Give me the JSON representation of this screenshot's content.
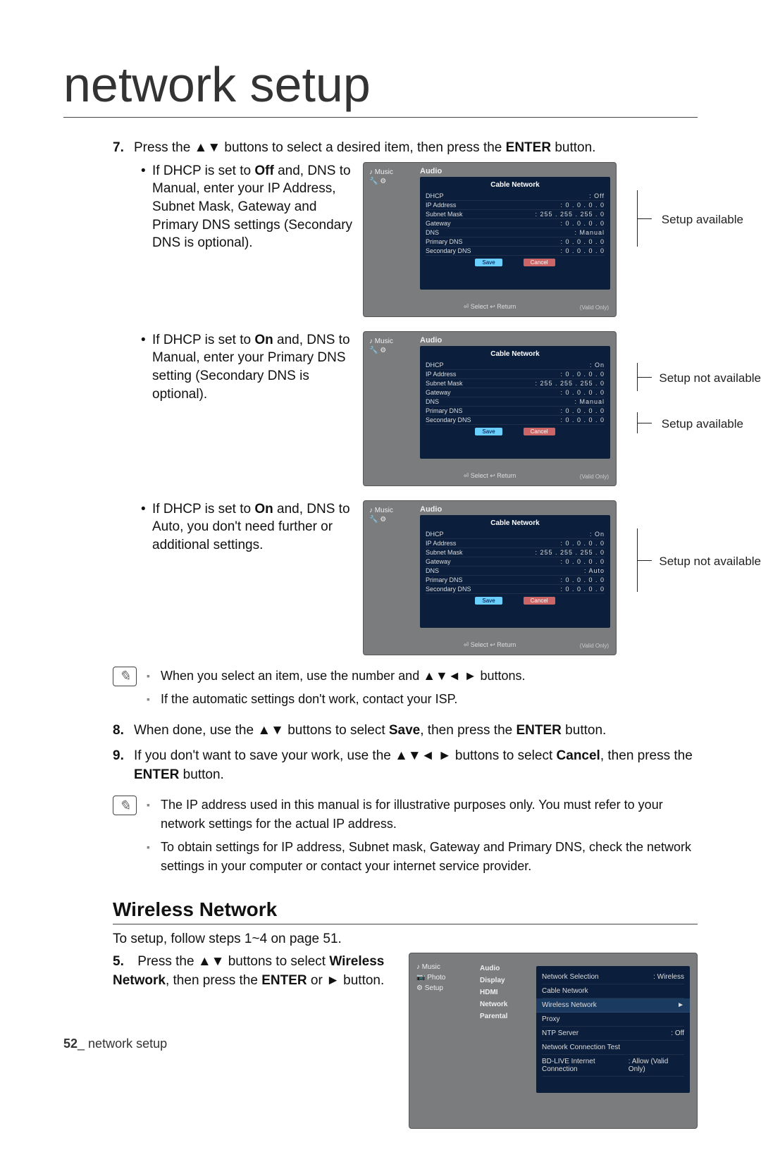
{
  "page_title": "network setup",
  "steps": {
    "s7": {
      "num": "7.",
      "text_pre": "Press the ▲▼ buttons to select a desired item, then press the ",
      "enter": "ENTER",
      "text_post": " button."
    },
    "bullets": [
      {
        "dot": "•",
        "line1": "If DHCP is set to ",
        "b1": "Off",
        "line2": " and, DNS to Manual, enter your IP Address, Subnet Mask, Gateway and Primary DNS settings (Secondary DNS is optional).",
        "annot1": "Setup available"
      },
      {
        "dot": "•",
        "line1": "If DHCP is set to ",
        "b1": "On",
        "line2": " and, DNS to Manual, enter your Primary DNS setting (Secondary DNS is optional).",
        "annot1": "Setup not available",
        "annot2": "Setup available"
      },
      {
        "dot": "•",
        "line1": "If DHCP is set to ",
        "b1": "On",
        "line2": " and, DNS to Auto, you don't need further or additional settings.",
        "annot1": "Setup not available"
      }
    ],
    "s8": {
      "num": "8.",
      "text_pre": "When done, use the ▲▼ buttons to select ",
      "save": "Save",
      "text_mid": ", then press the ",
      "enter": "ENTER",
      "text_post": " button."
    },
    "s9": {
      "num": "9.",
      "text_pre": "If you don't want to save your work, use the ▲▼◄ ► buttons to select ",
      "cancel": "Cancel",
      "text_mid": ", then press the ",
      "enter": "ENTER",
      "text_post": " button."
    }
  },
  "notes1": [
    "When you select an item, use the number and ▲▼◄ ► buttons.",
    "If the automatic settings don't work, contact your ISP."
  ],
  "notes2": [
    "The IP address used in this manual is for illustrative purposes only. You must refer to your network settings for the actual IP address.",
    "To obtain settings for IP address, Subnet mask, Gateway and Primary DNS, check the network settings in your computer or contact your internet service provider."
  ],
  "wireless_heading": "Wireless Network",
  "wireless_intro": "To setup, follow steps 1~4 on page 51.",
  "wireless_step5": {
    "num": "5.",
    "text_pre": "Press the ▲▼ buttons to select ",
    "label": "Wireless Network",
    "text_mid": ", then press the ",
    "enter": "ENTER",
    "text_post": " or ► button."
  },
  "osd_common": {
    "sidebar_music": "♪  Music",
    "audio_tab": "Audio",
    "panel_title": "Cable Network",
    "rows": {
      "DHCP": "DHCP",
      "IP": "IP Address",
      "Subnet": "Subnet Mask",
      "Gateway": "Gateway",
      "DNS": "DNS",
      "PDNS": "Primary DNS",
      "SDNS": "Secondary DNS"
    },
    "btn_save": "Save",
    "btn_cancel": "Cancel",
    "hint": "⏎ Select   ↩ Return",
    "valid": "(Valid Only)"
  },
  "osd1_vals": {
    "DHCP": ": Off",
    "IP": ":   0 .   0 .   0 .   0",
    "Subnet": ": 255 . 255 . 255 .   0",
    "Gateway": ":   0 .   0 .   0 .   0",
    "DNS": ": Manual",
    "PDNS": ":   0 .   0 .   0 .   0",
    "SDNS": ":   0 .   0 .   0 .   0"
  },
  "osd2_vals": {
    "DHCP": ": On",
    "IP": ":   0 .   0 .   0 .   0",
    "Subnet": ": 255 . 255 . 255 .   0",
    "Gateway": ":   0 .   0 .   0 .   0",
    "DNS": ": Manual",
    "PDNS": ":   0 .   0 .   0 .   0",
    "SDNS": ":   0 .   0 .   0 .   0"
  },
  "osd3_vals": {
    "DHCP": ": On",
    "IP": ":   0 .   0 .   0 .   0",
    "Subnet": ": 255 . 255 . 255 .   0",
    "Gateway": ":   0 .   0 .   0 .   0",
    "DNS": ": Auto",
    "PDNS": ":   0 .   0 .   0 .   0",
    "SDNS": ":   0 .   0 .   0 .   0"
  },
  "osd_wireless": {
    "sidebar": {
      "music": "♪  Music",
      "photo": "📷  Photo",
      "setup": "⚙  Setup"
    },
    "menu": {
      "audio": "Audio",
      "display": "Display",
      "hdmi": "HDMI",
      "network": "Network",
      "parental": "Parental"
    },
    "rows": [
      {
        "label": "Network Selection",
        "val": ": Wireless"
      },
      {
        "label": "Cable Network",
        "val": ""
      },
      {
        "label": "Wireless Network",
        "val": "►"
      },
      {
        "label": "Proxy",
        "val": ""
      },
      {
        "label": "NTP Server",
        "val": ": Off"
      },
      {
        "label": "Network Connection Test",
        "val": ""
      },
      {
        "label": "BD-LIVE Internet Connection",
        "val": ": Allow (Valid Only)"
      }
    ]
  },
  "footer": {
    "pagenum": "52",
    "sep": "_ ",
    "label": "network setup"
  }
}
